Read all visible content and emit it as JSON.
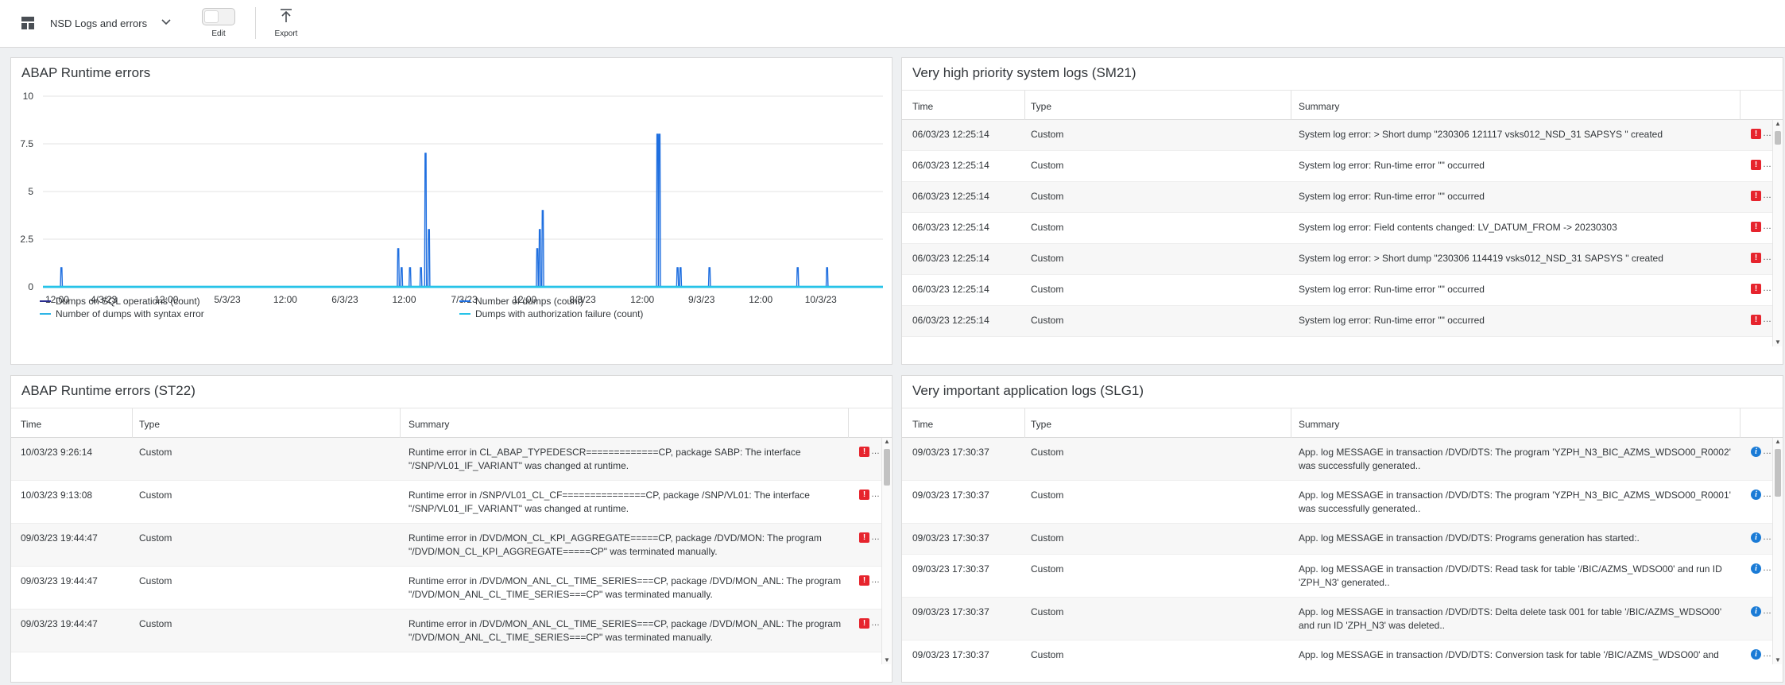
{
  "toolbar": {
    "dashboard_title": "NSD Logs and errors",
    "edit_label": "Edit",
    "export_label": "Export",
    "edit_mode_on": false
  },
  "colors": {
    "error": "#e6242d",
    "info": "#1a7bd6",
    "series_sql": "#2a2d8f",
    "series_dumps": "#1f6fe0",
    "series_syntax": "#2fb5e6",
    "series_auth": "#27c3e8"
  },
  "chart_panel": {
    "title": "ABAP Runtime errors",
    "chart_data": {
      "type": "line",
      "title": "ABAP Runtime errors",
      "xlabel": "",
      "ylabel": "",
      "ylim": [
        0,
        10
      ],
      "yticks": [
        {
          "value": 10,
          "label": "10"
        },
        {
          "value": 7.5,
          "label": "7.5"
        },
        {
          "value": 5,
          "label": "5"
        },
        {
          "value": 2.5,
          "label": "2.5"
        },
        {
          "value": 0,
          "label": "0"
        }
      ],
      "xlim": [
        0,
        1
      ],
      "xticks": [
        {
          "pos": 0.017,
          "label": "12:00"
        },
        {
          "pos": 0.0725,
          "label": "4/3/23"
        },
        {
          "pos": 0.147,
          "label": "12:00"
        },
        {
          "pos": 0.2195,
          "label": "5/3/23"
        },
        {
          "pos": 0.2885,
          "label": "12:00"
        },
        {
          "pos": 0.3595,
          "label": "6/3/23"
        },
        {
          "pos": 0.43,
          "label": "12:00"
        },
        {
          "pos": 0.5015,
          "label": "7/3/23"
        },
        {
          "pos": 0.5735,
          "label": "12:00"
        },
        {
          "pos": 0.6425,
          "label": "8/3/23"
        },
        {
          "pos": 0.7135,
          "label": "12:00"
        },
        {
          "pos": 0.784,
          "label": "9/3/23"
        },
        {
          "pos": 0.8545,
          "label": "12:00"
        },
        {
          "pos": 0.926,
          "label": "10/3/23"
        }
      ],
      "grid": true,
      "legend_position": "bottom",
      "series": [
        {
          "name": "Dumps on SQL operations (count)",
          "color_key": "series_sql",
          "points": []
        },
        {
          "name": "Number of dumps (count)",
          "color_key": "series_dumps",
          "points": [
            {
              "x": 0.022,
              "y": 1
            },
            {
              "x": 0.423,
              "y": 2
            },
            {
              "x": 0.427,
              "y": 1
            },
            {
              "x": 0.437,
              "y": 1
            },
            {
              "x": 0.45,
              "y": 1
            },
            {
              "x": 0.4555,
              "y": 7
            },
            {
              "x": 0.4595,
              "y": 3
            },
            {
              "x": 0.5885,
              "y": 2
            },
            {
              "x": 0.5915,
              "y": 3
            },
            {
              "x": 0.595,
              "y": 4
            },
            {
              "x": 0.7315,
              "y": 8
            },
            {
              "x": 0.734,
              "y": 8
            },
            {
              "x": 0.7555,
              "y": 1
            },
            {
              "x": 0.759,
              "y": 1
            },
            {
              "x": 0.7935,
              "y": 1
            },
            {
              "x": 0.8985,
              "y": 1
            },
            {
              "x": 0.9335,
              "y": 1
            }
          ]
        },
        {
          "name": "Number of dumps with syntax error",
          "color_key": "series_syntax",
          "points": []
        },
        {
          "name": "Dumps with authorization failure (count)",
          "color_key": "series_auth",
          "points": []
        }
      ]
    }
  },
  "sm21": {
    "title": "Very high priority system logs (SM21)",
    "columns": [
      "Time",
      "Type",
      "Summary"
    ],
    "rows": [
      {
        "time": "06/03/23 12:25:14",
        "type": "Custom",
        "summary": "System log error: > Short dump \"230306 121117 vsks012_NSD_31 SAPSYS \" created",
        "summary2": "",
        "level": "error"
      },
      {
        "time": "06/03/23 12:25:14",
        "type": "Custom",
        "summary": "System log error: Run-time error \"\" occurred",
        "summary2": "",
        "level": "error"
      },
      {
        "time": "06/03/23 12:25:14",
        "type": "Custom",
        "summary": "System log error: Run-time error \"\" occurred",
        "summary2": "",
        "level": "error"
      },
      {
        "time": "06/03/23 12:25:14",
        "type": "Custom",
        "summary": "System log error: Field contents changed: LV_DATUM_FROM -> 20230303",
        "summary2": "",
        "level": "error"
      },
      {
        "time": "06/03/23 12:25:14",
        "type": "Custom",
        "summary": "System log error: > Short dump \"230306 114419 vsks012_NSD_31 SAPSYS \" created",
        "summary2": "",
        "level": "error"
      },
      {
        "time": "06/03/23 12:25:14",
        "type": "Custom",
        "summary": "System log error: Run-time error \"\" occurred",
        "summary2": "",
        "level": "error"
      },
      {
        "time": "06/03/23 12:25:14",
        "type": "Custom",
        "summary": "System log error: Run-time error \"\" occurred",
        "summary2": "",
        "level": "error"
      }
    ]
  },
  "st22": {
    "title": "ABAP Runtime errors (ST22)",
    "columns": [
      "Time",
      "Type",
      "Summary"
    ],
    "rows": [
      {
        "time": "10/03/23 9:26:14",
        "type": "Custom",
        "summary": "Runtime error in CL_ABAP_TYPEDESCR=============CP, package SABP: The interface",
        "summary2": "\"/SNP/VL01_IF_VARIANT\" was changed at runtime.",
        "level": "error"
      },
      {
        "time": "10/03/23 9:13:08",
        "type": "Custom",
        "summary": "Runtime error in /SNP/VL01_CL_CF===============CP, package /SNP/VL01: The interface",
        "summary2": "\"/SNP/VL01_IF_VARIANT\" was changed at runtime.",
        "level": "error"
      },
      {
        "time": "09/03/23 19:44:47",
        "type": "Custom",
        "summary": "Runtime error in /DVD/MON_CL_KPI_AGGREGATE=====CP, package /DVD/MON: The program",
        "summary2": "\"/DVD/MON_CL_KPI_AGGREGATE=====CP\" was terminated manually.",
        "level": "error"
      },
      {
        "time": "09/03/23 19:44:47",
        "type": "Custom",
        "summary": "Runtime error in /DVD/MON_ANL_CL_TIME_SERIES===CP, package /DVD/MON_ANL: The program",
        "summary2": "\"/DVD/MON_ANL_CL_TIME_SERIES===CP\" was terminated manually.",
        "level": "error"
      },
      {
        "time": "09/03/23 19:44:47",
        "type": "Custom",
        "summary": "Runtime error in /DVD/MON_ANL_CL_TIME_SERIES===CP, package /DVD/MON_ANL: The program",
        "summary2": "\"/DVD/MON_ANL_CL_TIME_SERIES===CP\" was terminated manually.",
        "level": "error"
      }
    ]
  },
  "slg1": {
    "title": "Very important application logs (SLG1)",
    "columns": [
      "Time",
      "Type",
      "Summary"
    ],
    "rows": [
      {
        "time": "09/03/23 17:30:37",
        "type": "Custom",
        "summary": "App. log MESSAGE in transaction /DVD/DTS: The program 'YZPH_N3_BIC_AZMS_WDSO00_R0002'",
        "summary2": "was successfully generated..",
        "level": "info"
      },
      {
        "time": "09/03/23 17:30:37",
        "type": "Custom",
        "summary": "App. log MESSAGE in transaction /DVD/DTS: The program 'YZPH_N3_BIC_AZMS_WDSO00_R0001'",
        "summary2": "was successfully generated..",
        "level": "info"
      },
      {
        "time": "09/03/23 17:30:37",
        "type": "Custom",
        "summary": "App. log MESSAGE in transaction /DVD/DTS: Programs generation has started:.",
        "summary2": "",
        "level": "info"
      },
      {
        "time": "09/03/23 17:30:37",
        "type": "Custom",
        "summary": "App. log MESSAGE in transaction /DVD/DTS: Read task for table '/BIC/AZMS_WDSO00' and run ID",
        "summary2": "'ZPH_N3' generated..",
        "level": "info"
      },
      {
        "time": "09/03/23 17:30:37",
        "type": "Custom",
        "summary": "App. log MESSAGE in transaction /DVD/DTS: Delta delete task 001 for table '/BIC/AZMS_WDSO00'",
        "summary2": "and run ID 'ZPH_N3' was deleted..",
        "level": "info"
      },
      {
        "time": "09/03/23 17:30:37",
        "type": "Custom",
        "summary": "App. log MESSAGE in transaction /DVD/DTS: Conversion task for table '/BIC/AZMS_WDSO00' and",
        "summary2": "",
        "level": "info"
      }
    ]
  }
}
